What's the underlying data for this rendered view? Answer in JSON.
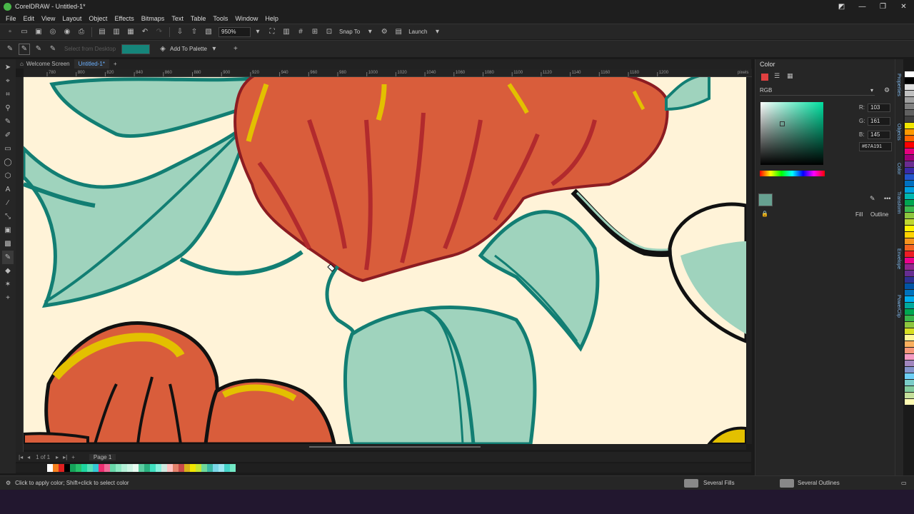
{
  "app": {
    "title": "CorelDRAW - Untitled-1*"
  },
  "menu": [
    "File",
    "Edit",
    "View",
    "Layout",
    "Object",
    "Effects",
    "Bitmaps",
    "Text",
    "Table",
    "Tools",
    "Window",
    "Help"
  ],
  "toolbar": {
    "zoom": "950%",
    "snap_to": "Snap To",
    "launch": "Launch"
  },
  "propbar": {
    "select_from_desktop": "Select from Desktop",
    "add_to_palette": "Add To Palette",
    "current_color": "#15857a"
  },
  "tabs": [
    {
      "label": "Welcome Screen"
    },
    {
      "label": "Untitled-1*"
    }
  ],
  "ruler": {
    "ticks": [
      "780",
      "800",
      "820",
      "840",
      "860",
      "880",
      "900",
      "920",
      "940",
      "960",
      "980",
      "1000",
      "1020",
      "1040",
      "1060",
      "1080",
      "1100",
      "1120",
      "1140",
      "1160",
      "1180",
      "1200"
    ],
    "units": "pixels"
  },
  "pagebar": {
    "page_count": "1 of 1",
    "page_label": "Page 1"
  },
  "status": {
    "hint": "Click to apply color; Shift+click to select color",
    "fills": "Several Fills",
    "outlines": "Several Outlines"
  },
  "color_docker": {
    "title": "Color",
    "model": "RGB",
    "r_label": "R:",
    "r": "103",
    "g_label": "G:",
    "g": "161",
    "b_label": "B:",
    "b": "145",
    "hex": "#67A191",
    "fill_label": "Fill",
    "outline_label": "Outline",
    "swatch": "#67a191"
  },
  "right_dock_tabs": [
    "Properties",
    "Objects",
    "Color",
    "Transform",
    "Envelope",
    "PowerClip"
  ],
  "bottom_palette": [
    "#ffffff",
    "#f5811f",
    "#e02020",
    "#000000",
    "#15a35a",
    "#27c26b",
    "#1dd5a0",
    "#56e0b6",
    "#35c6d4",
    "#ed2e70",
    "#f06b99",
    "#68d7a9",
    "#8ee8c3",
    "#b4f0d7",
    "#cdf5e4",
    "#e8fbf1",
    "#5acda1",
    "#2ab07f",
    "#3fe0c0",
    "#88f0dd",
    "#cfe8df",
    "#ffc1c1",
    "#e3826b",
    "#c94a4a",
    "#d8b21a",
    "#f2e600",
    "#c4e533",
    "#6fd99a",
    "#3ab9a5",
    "#7ad7e8",
    "#9be6f2",
    "#44d3c8",
    "#72e8c5"
  ],
  "right_palette": [
    "#ffffff",
    "#000000",
    "#e0e0e0",
    "#c0c0c0",
    "#a0a0a0",
    "#808080",
    "#606060",
    "#404040",
    "#f2e600",
    "#ff9900",
    "#ff6600",
    "#ff0000",
    "#e6007e",
    "#a0007a",
    "#6a2c91",
    "#3a2ba6",
    "#2255cc",
    "#0070c0",
    "#00a0e0",
    "#00b8b0",
    "#00a651",
    "#3dba4e",
    "#8dc63f",
    "#bfd730",
    "#fff200",
    "#ffd200",
    "#f7941d",
    "#f26522",
    "#ed1c24",
    "#ec008c",
    "#92278f",
    "#662d91",
    "#2e3192",
    "#0054a6",
    "#0072bc",
    "#00aeef",
    "#00a99d",
    "#00a651",
    "#39b54a",
    "#8dc63f",
    "#d7df23",
    "#fff799",
    "#fbaf5d",
    "#f69679",
    "#f49ac2",
    "#a186be",
    "#8393ca",
    "#6dcff6",
    "#7accc8",
    "#82ca9c",
    "#c4df9b",
    "#fffbb3"
  ]
}
